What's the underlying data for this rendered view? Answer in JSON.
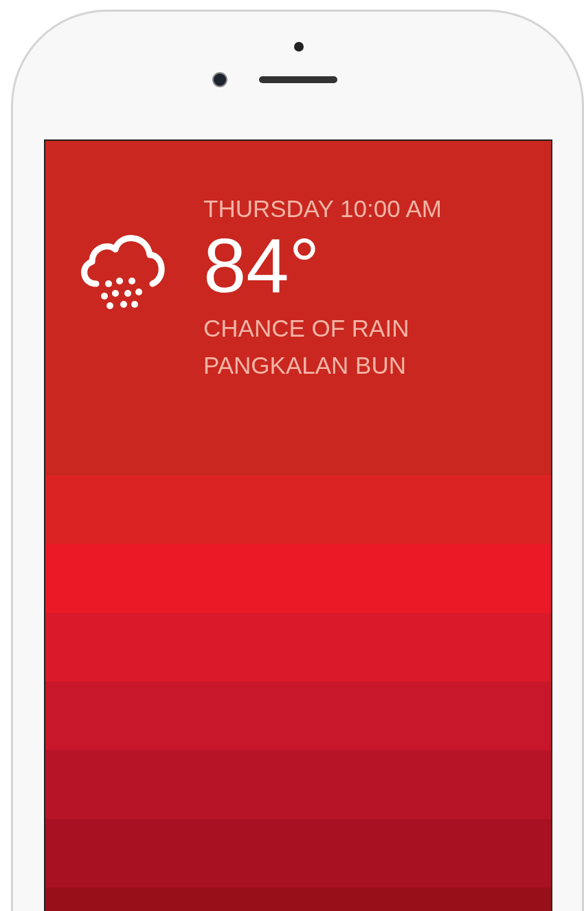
{
  "weather": {
    "day_time": "THURSDAY 10:00 AM",
    "temperature": "84°",
    "condition": "CHANCE OF RAIN",
    "location": "PANGKALAN BUN"
  },
  "bands": [
    {
      "color": "#c9271f"
    },
    {
      "color": "#dc2323"
    },
    {
      "color": "#e91a25"
    },
    {
      "color": "#d91a2b"
    },
    {
      "color": "#c8172a"
    },
    {
      "color": "#b81427"
    },
    {
      "color": "#a81121"
    },
    {
      "color": "#970f19"
    }
  ]
}
